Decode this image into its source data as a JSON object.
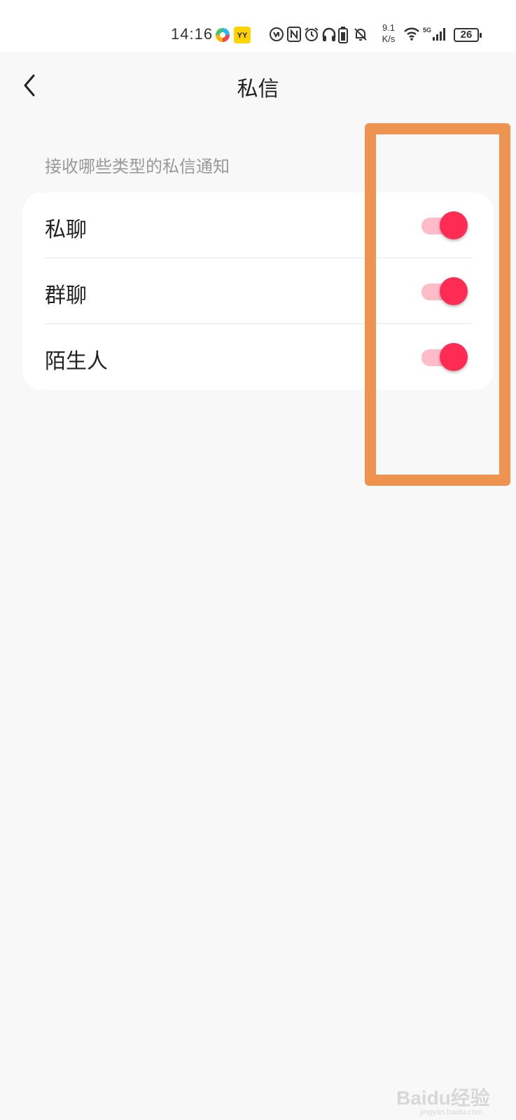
{
  "status_bar": {
    "time": "14:16",
    "net_speed_value": "9.1",
    "net_speed_unit": "K/s",
    "battery": "26",
    "icons": [
      "app-colorful-icon",
      "yy-app-icon",
      "vpn-icon",
      "nfc-icon",
      "alarm-icon",
      "headphones-icon",
      "battery-saver-icon",
      "mute-icon",
      "wifi-icon",
      "5g-signal-icon"
    ]
  },
  "header": {
    "title": "私信",
    "back_icon": "chevron-left-icon"
  },
  "section": {
    "label": "接收哪些类型的私信通知"
  },
  "settings": [
    {
      "label": "私聊",
      "enabled": true
    },
    {
      "label": "群聊",
      "enabled": true
    },
    {
      "label": "陌生人",
      "enabled": true
    }
  ],
  "colors": {
    "accent": "#fe2c55",
    "highlight": "#ef9450",
    "background": "#f8f8f8",
    "card": "#ffffff"
  },
  "watermark": {
    "text": "Baidu经验",
    "url": "jingyan.baidu.com"
  }
}
